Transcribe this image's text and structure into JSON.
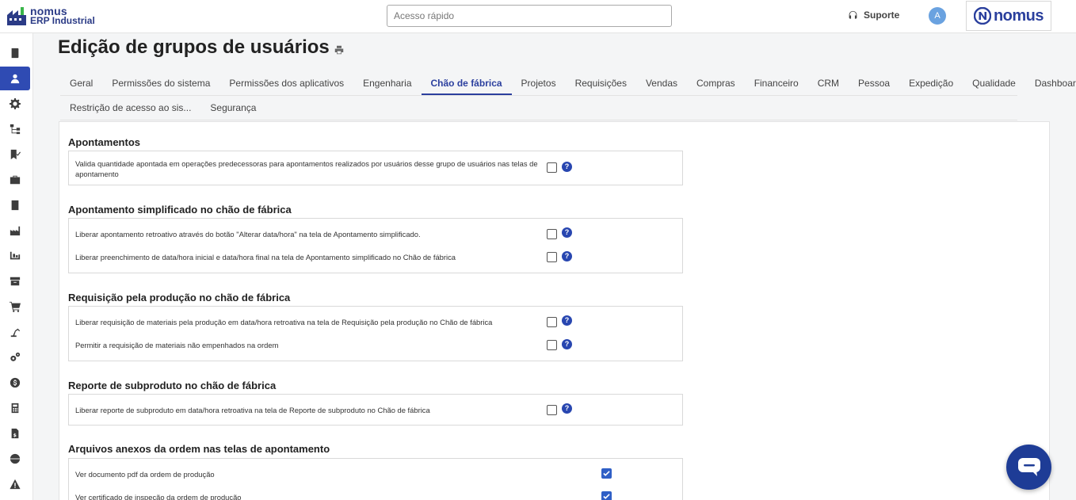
{
  "brand": {
    "name": "nomus",
    "product": "ERP Industrial"
  },
  "header": {
    "quick_access_placeholder": "Acesso rápido",
    "support_label": "Suporte",
    "avatar_initial": "A",
    "logo_text": "nomus"
  },
  "sidebar": {
    "items": [
      {
        "icon": "book-icon"
      },
      {
        "icon": "user-icon",
        "active": true
      },
      {
        "icon": "gear-icon"
      },
      {
        "icon": "hierarchy-icon"
      },
      {
        "icon": "bookmark-check-icon"
      },
      {
        "icon": "briefcase-icon"
      },
      {
        "icon": "ledger-icon"
      },
      {
        "icon": "factory-icon"
      },
      {
        "icon": "pallet-icon"
      },
      {
        "icon": "archive-icon"
      },
      {
        "icon": "cart-icon"
      },
      {
        "icon": "robot-arm-icon"
      },
      {
        "icon": "gears-icon"
      },
      {
        "icon": "dollar-icon"
      },
      {
        "icon": "calculator-icon"
      },
      {
        "icon": "invoice-icon"
      },
      {
        "icon": "globe-icon"
      },
      {
        "icon": "warning-icon"
      }
    ]
  },
  "page": {
    "title": "Edição de grupos de usuários"
  },
  "tabs": {
    "row1": [
      "Geral",
      "Permissões do sistema",
      "Permissões dos aplicativos",
      "Engenharia",
      "Chão de fábrica",
      "Projetos",
      "Requisições",
      "Vendas",
      "Compras",
      "Financeiro",
      "CRM",
      "Pessoa",
      "Expedição",
      "Qualidade",
      "Dashboard"
    ],
    "row2": [
      "Restrição de acesso ao sis...",
      "Segurança"
    ],
    "active": "Chão de fábrica"
  },
  "sections": [
    {
      "title": "Apontamentos",
      "options": [
        {
          "label": "Valida quantidade apontada em operações predecessoras para apontamentos realizados por usuários desse grupo de usuários nas telas de apontamento",
          "checked": false,
          "help": "?"
        }
      ]
    },
    {
      "title": "Apontamento simplificado no chão de fábrica",
      "options": [
        {
          "label": "Liberar apontamento retroativo através do botão \"Alterar data/hora\" na tela de Apontamento simplificado.",
          "checked": false,
          "help": "?"
        },
        {
          "label": "Liberar preenchimento de data/hora inicial e data/hora final na tela de Apontamento simplificado no Chão de fábrica",
          "checked": false,
          "help": "?"
        }
      ]
    },
    {
      "title": "Requisição pela produção no chão de fábrica",
      "options": [
        {
          "label": "Liberar requisição de materiais pela produção em data/hora retroativa na tela de Requisição pela produção no Chão de fábrica",
          "checked": false,
          "help": "?"
        },
        {
          "label": "Permitir a requisição de materiais não empenhados na ordem",
          "checked": false,
          "help": "?"
        }
      ]
    },
    {
      "title": "Reporte de subproduto no chão de fábrica",
      "options": [
        {
          "label": "Liberar reporte de subproduto em data/hora retroativa na tela de Reporte de subproduto no Chão de fábrica",
          "checked": false,
          "help": "?"
        }
      ]
    },
    {
      "title": "Arquivos anexos da ordem nas telas de apontamento",
      "options": [
        {
          "label": "Ver documento pdf da ordem de produção",
          "checked": true
        },
        {
          "label": "Ver certificado de inspeção da ordem de produção",
          "checked": true
        }
      ]
    }
  ],
  "colors": {
    "accent": "#2b3f9e",
    "help": "#2846b0",
    "checked": "#2f5fc6",
    "chat": "#1e3c96"
  }
}
